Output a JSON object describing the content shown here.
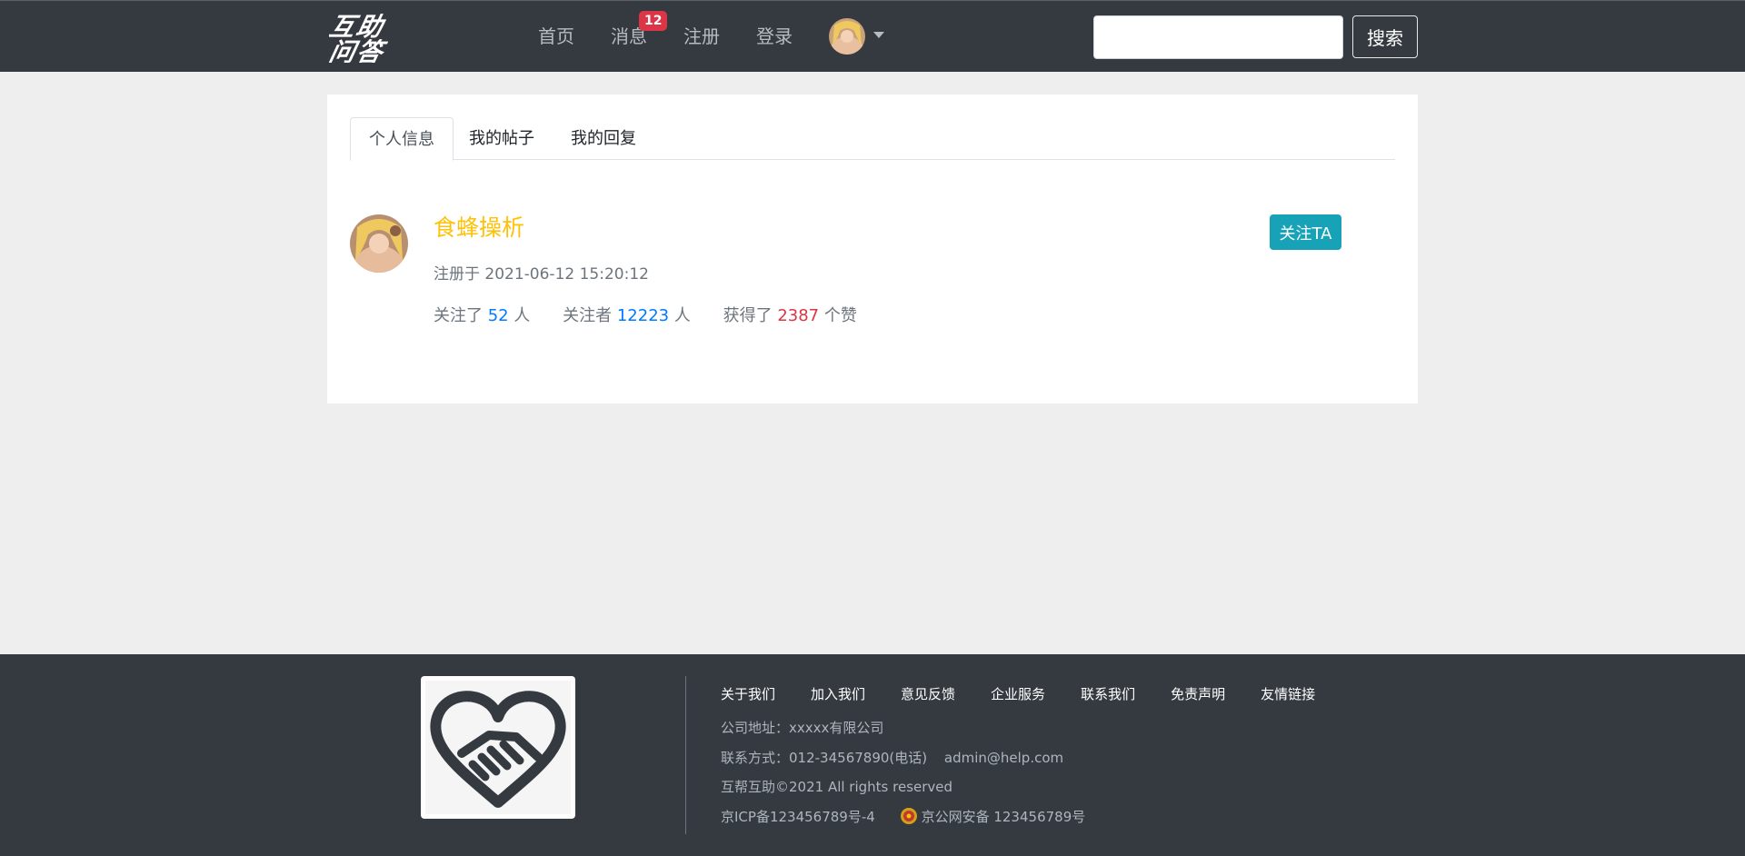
{
  "navbar": {
    "logo_text_line1": "互助",
    "logo_text_line2": "问答",
    "links": [
      "首页",
      "消息",
      "注册",
      "登录"
    ],
    "message_badge": "12",
    "search": {
      "placeholder": "",
      "button": "搜索"
    }
  },
  "tabs": [
    "个人信息",
    "我的帖子",
    "我的回复"
  ],
  "active_tab": "个人信息",
  "profile": {
    "username": "食蜂操析",
    "registered_label": "注册于",
    "registered_at": "2021-06-12 15:20:12",
    "following_prefix": "关注了",
    "following_count": "52",
    "following_suffix": "人",
    "followers_prefix": "关注者",
    "followers_count": "12223",
    "followers_suffix": "人",
    "likes_prefix": "获得了",
    "likes_count": "2387",
    "likes_suffix": "个赞",
    "follow_button": "关注TA"
  },
  "footer": {
    "links": [
      "关于我们",
      "加入我们",
      "意见反馈",
      "企业服务",
      "联系我们",
      "免责声明",
      "友情链接"
    ],
    "address": "公司地址：xxxxx有限公司",
    "contact_label": "联系方式：",
    "contact_phone": "012-34567890(电话)",
    "contact_email": "admin@help.com",
    "copyright": "互帮互助©2021 All rights reserved",
    "icp": "京ICP备123456789号-4",
    "police": "京公网安备 123456789号"
  },
  "colors": {
    "navbar": "#343a40",
    "badge": "#dc3545",
    "username": "#ffc107",
    "follow_button": "#17a2b8",
    "count_blue": "#007bff",
    "count_red": "#dc3545"
  }
}
